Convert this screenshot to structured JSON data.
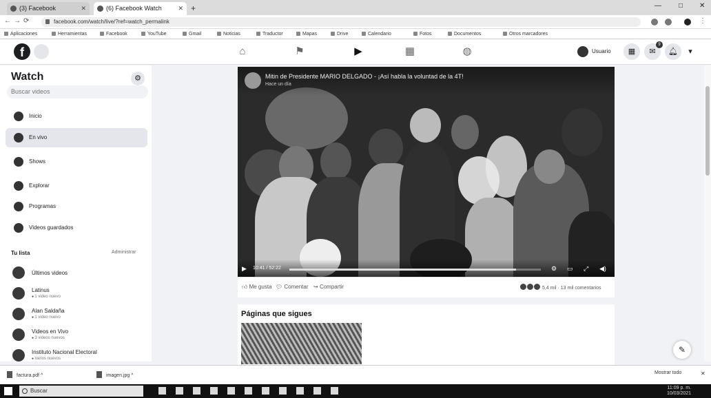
{
  "browser": {
    "tabs": [
      {
        "title": "(3) Facebook",
        "active": false
      },
      {
        "title": "(6) Facebook Watch",
        "active": true
      }
    ],
    "url": "facebook.com/watch/live/?ref=watch_permalink",
    "bookmarks": [
      "Aplicaciones",
      "Herramientas",
      "Facebook",
      "YouTube",
      "Gmail",
      "Noticias",
      "Traductor",
      "Mapas",
      "Drive",
      "Calendario",
      "Fotos",
      "Documentos",
      "Otros marcadores"
    ]
  },
  "fbnav": {
    "logo": "f",
    "items": [
      {
        "name": "home",
        "icon": "⌂"
      },
      {
        "name": "pages",
        "icon": "⚑"
      },
      {
        "name": "watch",
        "icon": "▶"
      },
      {
        "name": "marketplace",
        "icon": "▦"
      },
      {
        "name": "groups",
        "icon": "◍"
      }
    ],
    "profile_name": "Usuario",
    "notif_count": "9"
  },
  "sidebar": {
    "title": "Watch",
    "search_placeholder": "Buscar videos",
    "items": [
      {
        "label": "Inicio"
      },
      {
        "label": "En vivo"
      },
      {
        "label": "Shows"
      },
      {
        "label": "Explorar"
      },
      {
        "label": "Programas"
      },
      {
        "label": "Videos guardados"
      }
    ],
    "list_heading": "Tu lista",
    "manage": "Administrar",
    "following": [
      {
        "name": "Últimos videos",
        "status": ""
      },
      {
        "name": "Latinus",
        "status": "1 video nuevo"
      },
      {
        "name": "Alan Saldaña",
        "status": "1 video nuevo"
      },
      {
        "name": "Videos en Vivo",
        "status": "3 videos nuevos"
      },
      {
        "name": "Instituto Nacional Electoral",
        "status": "Varios nuevos"
      }
    ]
  },
  "video": {
    "title": "Mitin de Presidente MARIO DELGADO - ¡Así habla la voluntad de la 4T!",
    "subtitle": "Hace un día",
    "time": "10:41 / 52:22",
    "progress": 0.9,
    "actions": [
      "Me gusta",
      "Comentar",
      "Compartir"
    ],
    "reactions_text": "5,4 mil · 13 mil comentarios"
  },
  "follow_section": {
    "title": "Páginas que sigues"
  },
  "downloads": [
    {
      "file": "factura.pdf",
      "menu": "^"
    },
    {
      "file": "imagen.jpg",
      "menu": "^"
    }
  ],
  "download_show_all": "Mostrar todo",
  "taskbar": {
    "search_text": "Buscar",
    "time": "11:09 p. m.",
    "date": "10/03/2021"
  }
}
